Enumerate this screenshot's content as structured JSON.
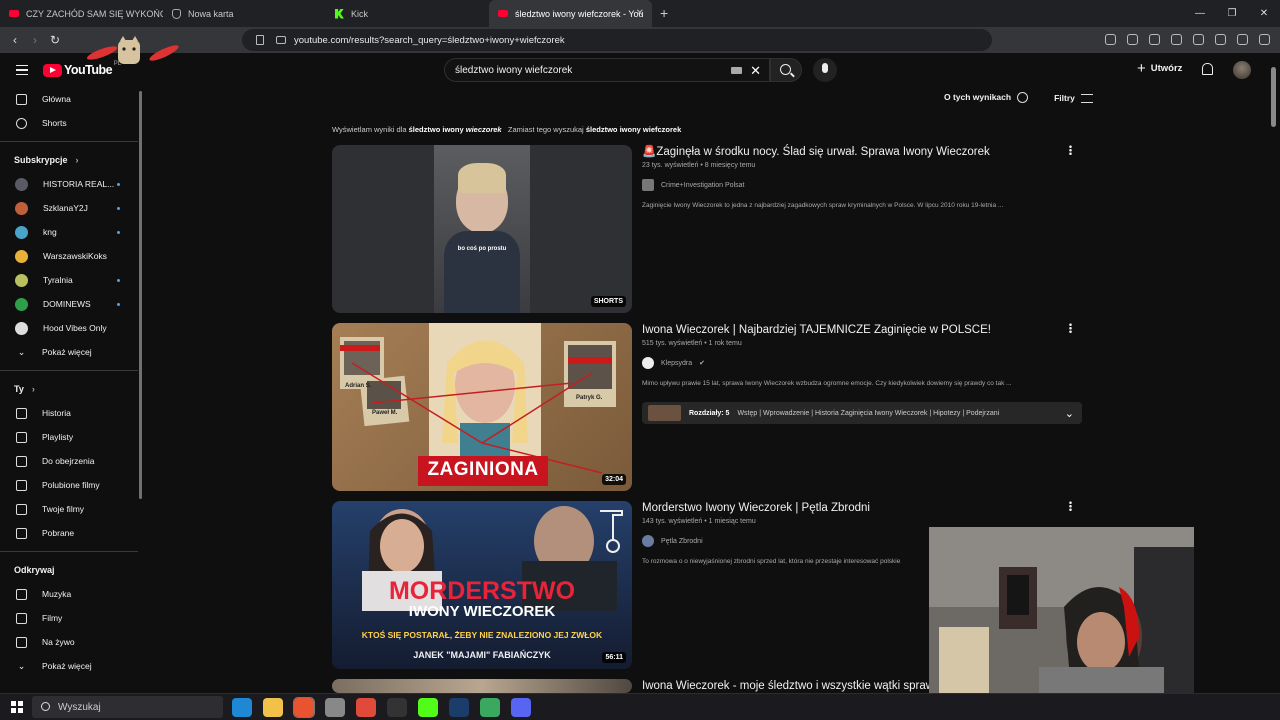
{
  "browser": {
    "tabs": [
      {
        "title": "CZY ZACHÓD SAM SIĘ WYKOŃCZY?",
        "favicon": "youtube-icon"
      },
      {
        "title": "Nowa karta",
        "favicon": "shield-icon"
      },
      {
        "title": "Kick",
        "favicon": "kick-icon"
      },
      {
        "title": "śledztwo iwony wiefczorek - You",
        "favicon": "youtube-icon"
      }
    ],
    "close_glyph": "✕",
    "new_tab_glyph": "+",
    "url": "youtube.com/results?search_query=śledztwo+iwony+wiefczorek",
    "window_controls": [
      "—",
      "❐",
      "✕"
    ]
  },
  "youtube": {
    "logo_text": "YouTube",
    "region": "PL",
    "search_value": "śledztwo iwony wiefczorek",
    "create_label": "Utwórz",
    "about_results": "O tych wynikach",
    "filters": "Filtry",
    "notice": {
      "showing_prefix": "Wyświetlam wyniki dla",
      "showing_query_a": "śledztwo iwony",
      "showing_query_b": "wieczorek",
      "instead_prefix": "Zamiast tego wyszukaj",
      "instead_query": "śledztwo iwony wiefczorek"
    }
  },
  "sidebar": {
    "main": [
      {
        "label": "Główna",
        "icon": "home-icon"
      },
      {
        "label": "Shorts",
        "icon": "shorts-icon"
      }
    ],
    "subs_header": "Subskrypcje",
    "subs": [
      {
        "label": "HISTORIA REAL...",
        "color": "#5a5a66",
        "dot": true
      },
      {
        "label": "SzklanaY2J",
        "color": "#c0603a",
        "dot": true
      },
      {
        "label": "kng",
        "color": "#4aa3c8",
        "dot": true
      },
      {
        "label": "WarszawskiKoks",
        "color": "#e8b23a",
        "dot": false
      },
      {
        "label": "Tyralnia",
        "color": "#b8c060",
        "dot": true
      },
      {
        "label": "DOMINEWS",
        "color": "#2e9e4a",
        "dot": true
      },
      {
        "label": "Hood Vibes Only",
        "color": "#dddddd",
        "dot": false
      }
    ],
    "show_more": "Pokaż więcej",
    "you_header": "Ty",
    "you": [
      {
        "label": "Historia",
        "icon": "history-icon"
      },
      {
        "label": "Playlisty",
        "icon": "playlist-icon"
      },
      {
        "label": "Do obejrzenia",
        "icon": "clock-icon"
      },
      {
        "label": "Polubione filmy",
        "icon": "thumbs-up-icon"
      },
      {
        "label": "Twoje filmy",
        "icon": "video-icon"
      },
      {
        "label": "Pobrane",
        "icon": "download-icon"
      }
    ],
    "explore_header": "Odkrywaj",
    "explore": [
      {
        "label": "Muzyka",
        "icon": "music-icon"
      },
      {
        "label": "Filmy",
        "icon": "film-icon"
      },
      {
        "label": "Na żywo",
        "icon": "live-icon"
      }
    ],
    "show_more_2": "Pokaż więcej"
  },
  "results": [
    {
      "title": "🚨Zaginęła w środku nocy. Ślad się urwał. Sprawa Iwony Wieczorek",
      "meta": "23 tys. wyświetleń • 8 miesięcy temu",
      "channel": "Crime+Investigation Polsat",
      "desc": "Zaginięcie Iwony Wieczorek to jedna z najbardziej zagadkowych spraw kryminalnych w Polsce. W lipcu 2010 roku 19-letnia ...",
      "badge": "SHORTS",
      "caption": "bo coś po prostu"
    },
    {
      "title": "Iwona Wieczorek | Najbardziej TAJEMNICZE Zaginięcie w POLSCE!",
      "meta": "515 tys. wyświetleń • 1 rok temu",
      "channel": "Klepsydra",
      "desc": "Mimo upływu prawie 15 lat, sprawa Iwony Wieczorek wzbudza ogromne emocje. Czy kiedykolwiek dowiemy się prawdy co tak ...",
      "duration": "32:04",
      "thumb_text": "ZAGINIONA",
      "chapters_label": "Rozdziały: 5",
      "chapters_list": "Wstęp | Wprowadzenie | Historia Zaginięcia Iwony Wieczorek | Hipotezy | Podejrzani",
      "pins": [
        "Adrian S.",
        "Paweł M.",
        "Patryk G."
      ]
    },
    {
      "title": "Morderstwo Iwony Wieczorek | Pętla Zbrodni",
      "meta": "143 tys. wyświetleń • 1 miesiąc temu",
      "channel": "Pętla Zbrodni",
      "desc": "To rozmowa o o niewyjaśnionej zbrodni sprzed lat, która nie przestaje interesować polskie",
      "duration": "56:11",
      "thumb_lines": [
        "MORDERSTWO",
        "IWONY WIECZOREK",
        "KTOŚ SIĘ POSTARAŁ, ŻEBY NIE ZNALEZIONO JEJ ZWŁOK",
        "JANEK \"MAJAMI\" FABIAŃCZYK"
      ]
    },
    {
      "title": "Iwona Wieczorek - moje śledztwo i wszystkie wątki sprawy."
    }
  ],
  "taskbar": {
    "search_placeholder": "Wyszukaj",
    "apps": [
      "edge-icon",
      "file-explorer-icon",
      "brave-icon",
      "app-icon",
      "chrome-icon",
      "obs-icon",
      "kick-icon",
      "steam-icon",
      "app-icon",
      "discord-icon"
    ],
    "app_colors": [
      "#1e88d4",
      "#f2c14a",
      "#e8542f",
      "#888888",
      "#e04a3a",
      "#333333",
      "#53fc18",
      "#1a3d6b",
      "#3aa85e",
      "#5865f2"
    ]
  }
}
